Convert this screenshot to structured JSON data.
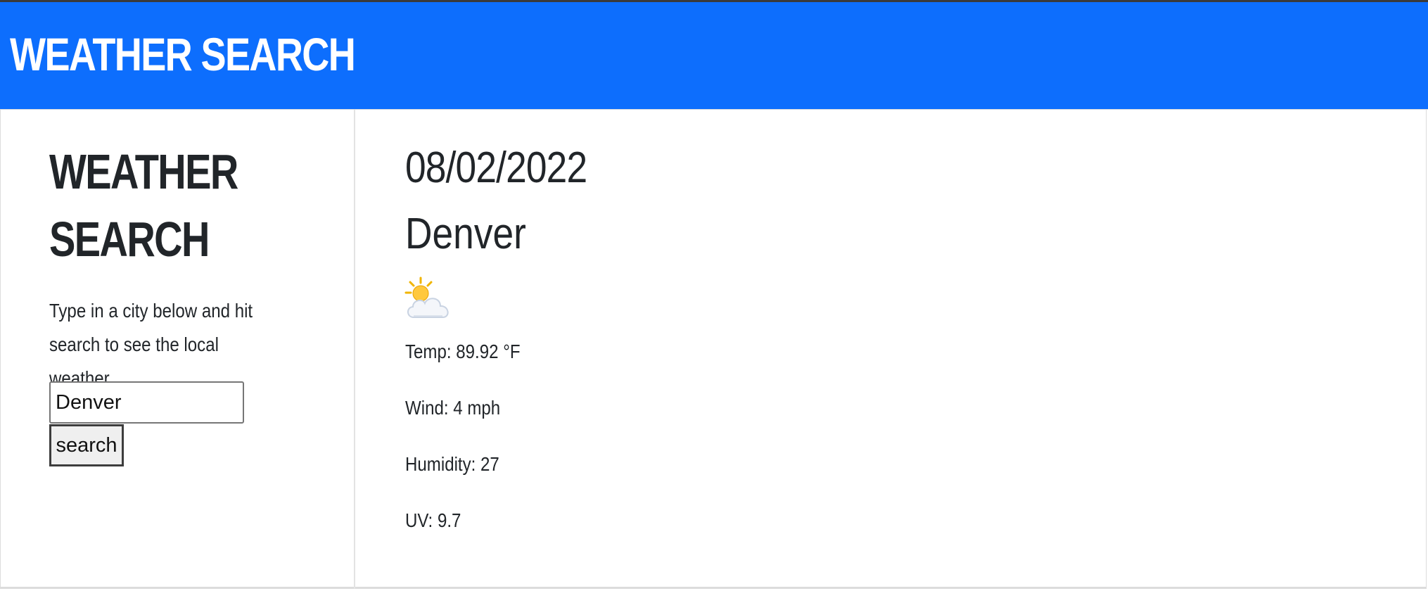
{
  "header": {
    "title": "WEATHER SEARCH"
  },
  "sidebar": {
    "title_line1": "WEATHER",
    "title_line2": "SEARCH",
    "description": "Type in a city below and hit search to see the local weather",
    "search_input": {
      "value": "Denver",
      "placeholder": ""
    },
    "search_button_label": "search"
  },
  "forecast": {
    "date": "08/02/2022",
    "city": "Denver",
    "icon": "sun-behind-cloud-icon",
    "temp": "Temp: 89.92 °F",
    "wind": "Wind: 4 mph",
    "humidity": "Humidity: 27",
    "uv": "UV: 9.7"
  },
  "colors": {
    "header_bg": "#0d6efd",
    "text": "#212529"
  }
}
